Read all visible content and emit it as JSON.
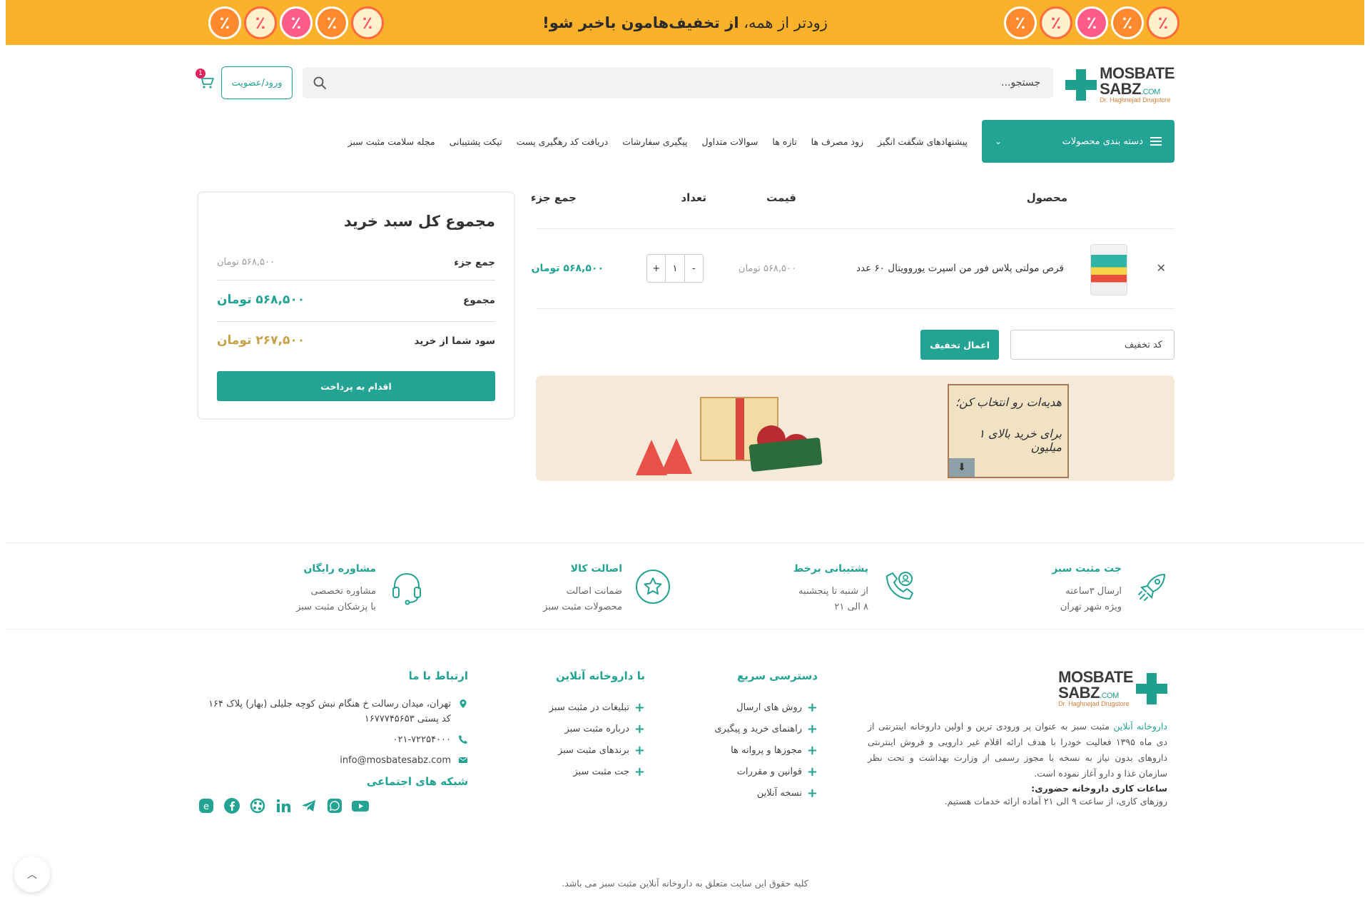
{
  "banner": {
    "text_prefix": "زودتر از همه، ",
    "text_bold": "از تخفیف‌هامون باخبر شو!"
  },
  "header": {
    "logo_line1": "MOSBATE",
    "logo_line2": "SABZ",
    "logo_com": ".COM",
    "logo_sub": "Dr. Haghnejad Drugstore",
    "search_placeholder": "جستجو...",
    "login_label": "ورود/عضویت",
    "cart_count": "1"
  },
  "nav": {
    "categories_label": "دسته بندی محصولات",
    "items": [
      "پیشنهادهای شگفت انگیز",
      "زود مصرف ها",
      "تازه ها",
      "سوالات متداول",
      "پیگیری سفارشات",
      "دریافت کد رهگیری پست",
      "تیکت پشتیبانی",
      "مجله سلامت مثبت سبز"
    ]
  },
  "cart_table": {
    "headers": {
      "product": "محصول",
      "price": "قیمت",
      "quantity": "تعداد",
      "subtotal": "جمع جزء"
    },
    "rows": [
      {
        "name": "قرص مولتی پلاس فور من اسپرت یوروویتال ۶۰ عدد",
        "price": "۵۶۸,۵۰۰ تومان",
        "quantity": "۱",
        "subtotal": "۵۶۸,۵۰۰ تومان"
      }
    ],
    "coupon_placeholder": "کد تخفیف",
    "apply_label": "اعمال تخفیف"
  },
  "promo": {
    "line1": "هدیه‌ات رو انتخاب کن؛",
    "line2": "برای خرید بالای ۱ میلیون"
  },
  "totals": {
    "title": "مجموع کل سبد خرید",
    "subtotal_label": "جمع جزء",
    "subtotal_value": "۵۶۸,۵۰۰ تومان",
    "total_label": "مجموع",
    "total_value": "۵۶۸,۵۰۰ تومان",
    "savings_label": "سود شما از خرید",
    "savings_value": "۲۶۷,۵۰۰ تومان",
    "checkout_label": "اقدام به پرداخت"
  },
  "features": [
    {
      "title": "جت مثبت سبز",
      "line1": "ارسال ۳ساعته",
      "line2": "ویژه شهر تهران",
      "icon": "rocket-icon"
    },
    {
      "title": "پشتیبانی برخط",
      "line1": "از شنبه تا پنجشنبه",
      "line2": "۸ الی ۲۱",
      "icon": "phone-support-icon"
    },
    {
      "title": "اصالت کالا",
      "line1": "ضمانت اصالت",
      "line2": "محصولات مثبت سبز",
      "icon": "star-badge-icon"
    },
    {
      "title": "مشاوره رایگان",
      "line1": "مشاوره تخصصی",
      "line2": "با پزشکان مثبت سبز",
      "icon": "headset-icon"
    }
  ],
  "footer": {
    "about_link": "داروخانه آنلاین",
    "about_text": " مثبت سبز به عنوان پر ورودی ترین و اولین داروخانه اینترنتی از دی ماه ۱۳۹۵ فعالیت خودرا با هدف ارائه اقلام غیر دارویی و فروش اینترنتی داروهای بدون نیاز به نسخه با مجوز رسمی از وزارت بهداشت و تحت نظر سازمان غذا و دارو آغاز نموده است.",
    "hours_title": "ساعات کاری داروخانه حضوری:",
    "hours_text": "روزهای کاری، از ساعت ۹ الی ۲۱ آماده ارائه خدمات هستیم.",
    "quick_title": "دسترسی سریع",
    "quick_links": [
      "روش های ارسال",
      "راهنمای خرید و پیگیری",
      "مجوزها و پروانه ها",
      "قوانین و مقررات",
      "نسخه آنلاین"
    ],
    "online_title": "با داروخانه آنلاین",
    "online_links": [
      "تبلیغات در مثبت سبز",
      "درباره مثبت سبز",
      "برندهای مثبت سبز",
      "جت مثبت سبز"
    ],
    "contact_title": "ارتباط با ما",
    "address": "تهران، میدان رسالت خ هنگام نبش کوچه جلیلی (بهار) پلاک ۱۶۴ کد پستی ۱۶۷۷۷۴۵۶۵۳",
    "phone": "۰۲۱-۷۲۲۵۴۰۰۰",
    "email": "info@mosbatesabz.com",
    "social_title": "شبکه های اجتماعی",
    "copyright": "کلیه حقوق این سایت متعلق به داروخانه آنلاین مثبت سبز می باشد."
  },
  "colors": {
    "accent": "#22a393",
    "banner": "#fbb12a",
    "savings": "#c8a24a"
  }
}
